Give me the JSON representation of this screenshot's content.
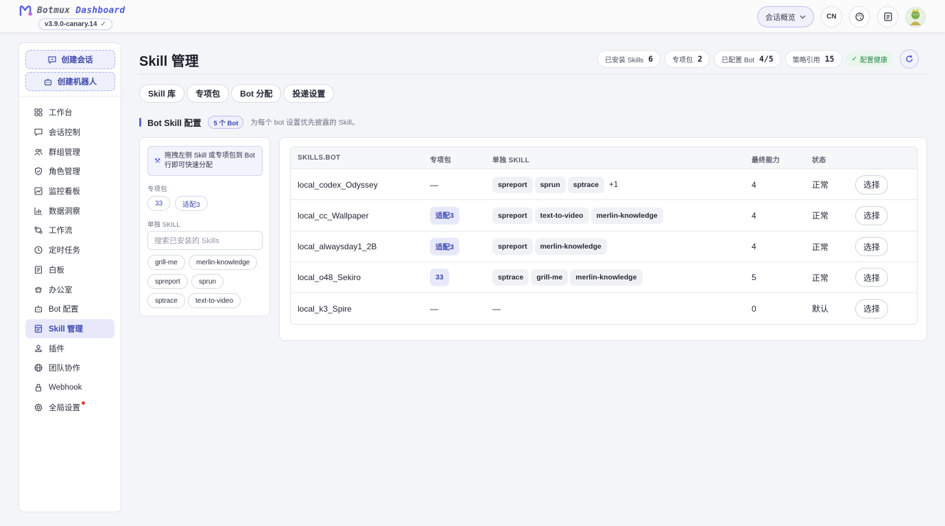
{
  "app": {
    "title_prefix": "Botmux",
    "title_suffix": "Dashboard",
    "version": "v3.9.0-canary.14",
    "version_check": "✓"
  },
  "header": {
    "overview_label": "会话概览",
    "lang_label": "CN",
    "icons": [
      "palette-icon",
      "notes-icon",
      "avatar"
    ]
  },
  "sidebar": {
    "create_session": "创建会话",
    "create_bot": "创建机器人",
    "items": [
      {
        "label": "工作台",
        "icon": "grid-icon"
      },
      {
        "label": "会话控制",
        "icon": "chat-icon"
      },
      {
        "label": "群组管理",
        "icon": "group-icon"
      },
      {
        "label": "角色管理",
        "icon": "shield-icon"
      },
      {
        "label": "监控看板",
        "icon": "monitor-icon"
      },
      {
        "label": "数据洞察",
        "icon": "bar-chart-icon"
      },
      {
        "label": "工作流",
        "icon": "workflow-icon"
      },
      {
        "label": "定时任务",
        "icon": "clock-icon"
      },
      {
        "label": "白板",
        "icon": "board-icon"
      },
      {
        "label": "办公室",
        "icon": "office-icon"
      },
      {
        "label": "Bot 配置",
        "icon": "bot-icon"
      },
      {
        "label": "Skill 管理",
        "icon": "skill-icon",
        "active": true
      },
      {
        "label": "插件",
        "icon": "plugin-icon"
      },
      {
        "label": "团队协作",
        "icon": "globe-icon"
      },
      {
        "label": "Webhook",
        "icon": "lock-icon"
      },
      {
        "label": "全局设置",
        "icon": "gear-icon",
        "badge": "red-dot"
      }
    ]
  },
  "page": {
    "title": "Skill 管理",
    "stats": [
      {
        "label": "已安装 Skills",
        "value": "6"
      },
      {
        "label": "专项包",
        "value": "2"
      },
      {
        "label": "已配置 Bot",
        "value": "4/5"
      },
      {
        "label": "策略引用",
        "value": "15"
      }
    ],
    "health": "配置健康",
    "tabs": [
      "Skill 库",
      "专项包",
      "Bot 分配",
      "投递设置"
    ]
  },
  "section": {
    "title": "Bot Skill 配置",
    "badge": "5 个 Bot",
    "desc": "为每个 bot 设置优先披露的 Skill。"
  },
  "left_panel": {
    "hint": "拖拽左侧 Skill 或专项包到 Bot 行即可快速分配",
    "packs_label": "专项包",
    "packs": [
      "33",
      "适配3"
    ],
    "skills_label": "单独 SKILL",
    "search_placeholder": "搜索已安装的 Skills",
    "skills": [
      "grill-me",
      "merlin-knowledge",
      "spreport",
      "sprun",
      "sptrace",
      "text-to-video"
    ]
  },
  "table": {
    "headers": [
      "SKILLS.BOT",
      "专项包",
      "单独 SKILL",
      "最终能力",
      "状态",
      ""
    ],
    "action_label": "选择",
    "rows": [
      {
        "bot": "local_codex_Odyssey",
        "pack": "—",
        "skills": [
          "spreport",
          "sprun",
          "sptrace"
        ],
        "more": "+1",
        "capability": "4",
        "status": "正常"
      },
      {
        "bot": "local_cc_Wallpaper",
        "pack": "适配3",
        "skills": [
          "spreport",
          "text-to-video",
          "merlin-knowledge"
        ],
        "more": "",
        "capability": "4",
        "status": "正常"
      },
      {
        "bot": "local_alwaysday1_2B",
        "pack": "适配3",
        "skills": [
          "spreport",
          "merlin-knowledge"
        ],
        "more": "",
        "capability": "4",
        "status": "正常"
      },
      {
        "bot": "local_o48_Sekiro",
        "pack": "33",
        "skills": [
          "sptrace",
          "grill-me",
          "merlin-knowledge"
        ],
        "more": "",
        "capability": "5",
        "status": "正常"
      },
      {
        "bot": "local_k3_Spire",
        "pack": "—",
        "skills": [],
        "skills_empty": "—",
        "more": "",
        "capability": "0",
        "status": "默认"
      }
    ]
  }
}
